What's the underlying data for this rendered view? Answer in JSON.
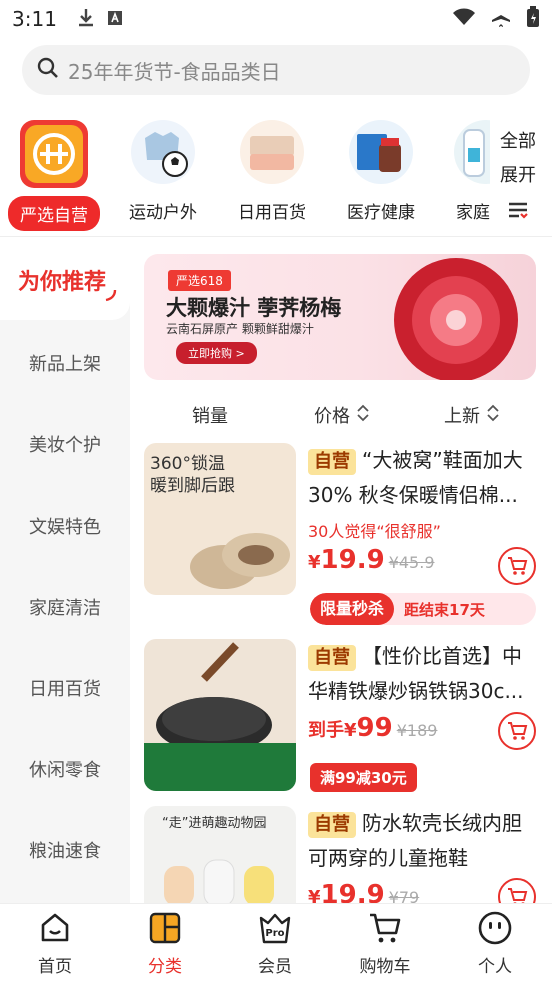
{
  "status": {
    "time": "3:11"
  },
  "search": {
    "placeholder": "25年年货节-食品品类日"
  },
  "categories": [
    {
      "label": "严选自营",
      "active": true
    },
    {
      "label": "运动户外"
    },
    {
      "label": "日用百货"
    },
    {
      "label": "医疗健康"
    },
    {
      "label": "家庭"
    }
  ],
  "all_categories": {
    "line1": "全部",
    "line2": "展开"
  },
  "side_menu": {
    "recommended": "为你推荐",
    "items": [
      "新品上架",
      "美妆个护",
      "文娱特色",
      "家庭清洁",
      "日用百货",
      "休闲零食",
      "粮油速食"
    ]
  },
  "banner": {
    "tag": "严选618",
    "title": "大颗爆汁 荸荠杨梅",
    "subtitle": "云南石屏原产 颗颗鲜甜爆汁",
    "cta": "立即抢购 >"
  },
  "sort": {
    "sales": "销量",
    "price": "价格",
    "new": "上新"
  },
  "products": [
    {
      "self_tag": "自营",
      "title": "“大被窝”鞋面加大30% 秋冬保暖情侣棉...",
      "note": "30人觉得“很舒服”",
      "price_prefix": "¥",
      "price": "19.9",
      "orig_price": "¥45.9",
      "flash_label": "限量秒杀",
      "flash_time": "距结束17天",
      "image_text1": "360°锁温",
      "image_text2": "暖到脚后跟"
    },
    {
      "self_tag": "自营",
      "title": "【性价比首选】中华精铁爆炒锅铁锅30c...",
      "price_prefix": "到手¥",
      "price": "99",
      "orig_price": "¥189",
      "discount": "满99减30元"
    },
    {
      "self_tag": "自营",
      "title": "防水软壳长绒内胆可两穿的儿童拖鞋",
      "price_prefix": "¥",
      "price": "19.9",
      "orig_price": "¥79",
      "image_text": "“走”进萌趣动物园"
    }
  ],
  "bottom_nav": [
    {
      "label": "首页"
    },
    {
      "label": "分类",
      "active": true
    },
    {
      "label": "会员"
    },
    {
      "label": "购物车"
    },
    {
      "label": "个人"
    }
  ],
  "colors": {
    "accent": "#e8312c",
    "self_tag_bg": "#fbe39a"
  }
}
